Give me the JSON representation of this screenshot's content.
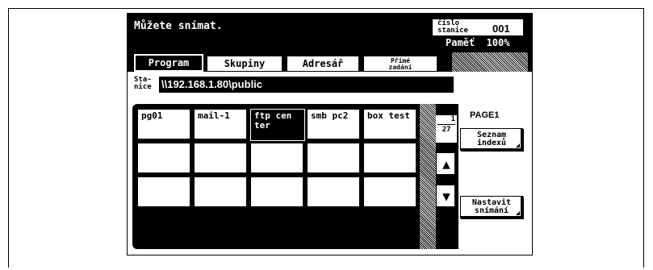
{
  "status": {
    "message": "Můžete snímat.",
    "station_label_line1": "číslo",
    "station_label_line2": "stanice",
    "station_number": "001",
    "memory_label": "Paměť",
    "memory_value": "100%"
  },
  "tabs": [
    {
      "label": "Program"
    },
    {
      "label": "Skupiny"
    },
    {
      "label": "Adresář"
    },
    {
      "label_line1": "Přímé",
      "label_line2": "zadání"
    }
  ],
  "station": {
    "label_line1": "Sta-",
    "label_line2": "nice",
    "value": "\\\\192.168.1.80\\public"
  },
  "destinations": [
    {
      "label": "pg01"
    },
    {
      "label": "mail-1"
    },
    {
      "label": "ftp cen ter"
    },
    {
      "label": "smb pc2"
    },
    {
      "label": "box test"
    }
  ],
  "pager": {
    "current": "1",
    "total": "27"
  },
  "panel": {
    "page_label": "PAGE1",
    "index_button_line1": "Seznam",
    "index_button_line2": "indexů",
    "scan_settings_line1": "Nastavit",
    "scan_settings_line2": "snímání"
  },
  "icons": {
    "up": "up-arrow-icon",
    "down": "down-arrow-icon"
  }
}
